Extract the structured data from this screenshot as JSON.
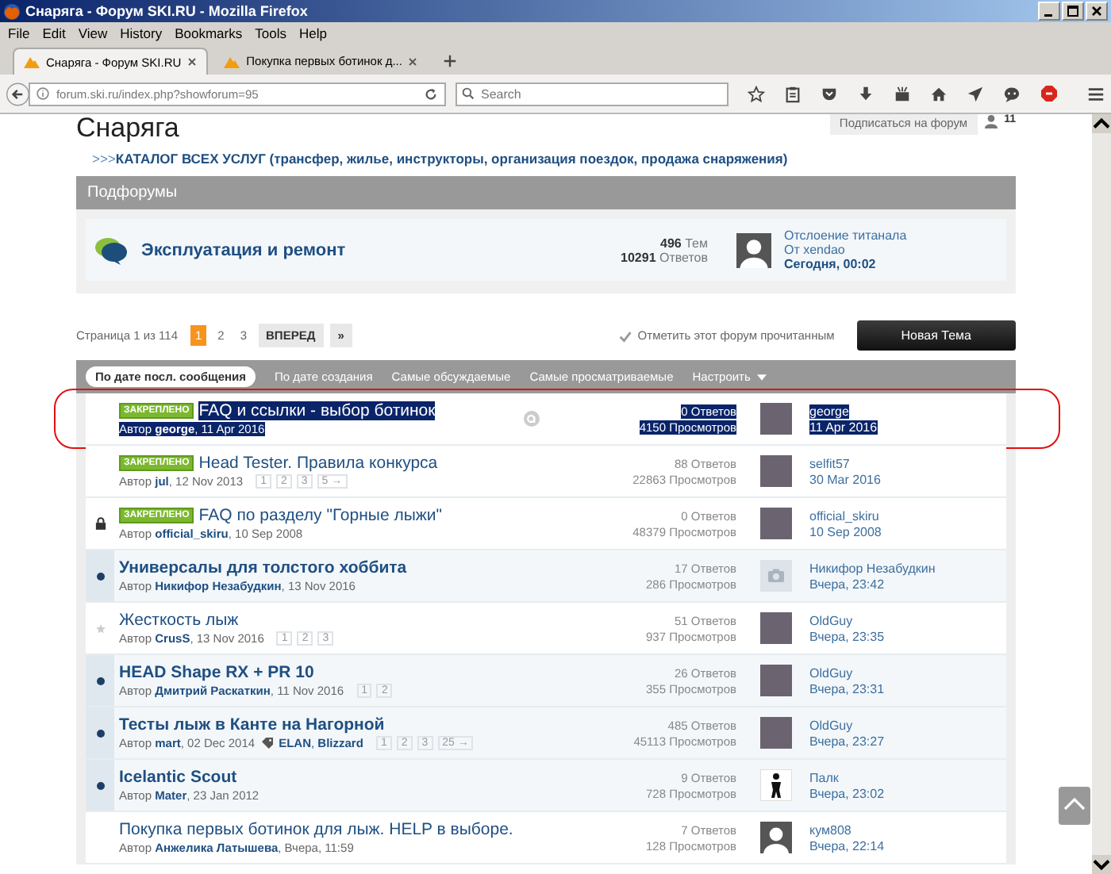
{
  "window": {
    "title": "Снаряга - Форум SKI.RU - Mozilla Firefox"
  },
  "menu": [
    {
      "label": "File"
    },
    {
      "label": "Edit"
    },
    {
      "label": "View"
    },
    {
      "label": "History"
    },
    {
      "label": "Bookmarks"
    },
    {
      "label": "Tools"
    },
    {
      "label": "Help"
    }
  ],
  "tabs": [
    {
      "label": "Снаряга - Форум SKI.RU",
      "selected": true
    },
    {
      "label": "Покупка первых ботинок д...",
      "selected": false
    }
  ],
  "address": {
    "url": "forum.ski.ru/index.php?showforum=95"
  },
  "search": {
    "placeholder": "Search"
  },
  "page": {
    "title": "Снаряга",
    "subscribe": "Подписаться на форум",
    "followers": "11",
    "catalog": ">>>**КАТАЛОГ ВСЕХ УСЛУГ (трансфер, жилье, инструкторы, организация поездок, продажа снаряжения)**"
  },
  "subforums": {
    "header": "Подфорумы",
    "items": [
      {
        "name": "Эксплуатация и ремонт",
        "topics_count": "496",
        "topics_label": "Тем",
        "replies_count": "10291",
        "replies_label": "Ответов",
        "last_title": "Отслоение титанала",
        "last_by": "От xendao",
        "last_date": "Сегодня, 00:02"
      }
    ]
  },
  "pagination": {
    "label": "Страница 1 из 114",
    "pages": [
      {
        "label": "1",
        "selected": true
      },
      {
        "label": "2",
        "selected": false
      },
      {
        "label": "3",
        "selected": false
      }
    ],
    "next": "ВПЕРЕД",
    "last": "»"
  },
  "mark_read": "Отметить этот форум прочитанным",
  "new_topic": "Новая Тема",
  "sort_tabs": [
    {
      "label": "По дате посл. сообщения",
      "selected": true
    },
    {
      "label": "По дате создания",
      "selected": false
    },
    {
      "label": "Самые обсуждаемые",
      "selected": false
    },
    {
      "label": "Самые просматриваемые",
      "selected": false
    }
  ],
  "customize": "Настроить",
  "topics": [
    {
      "unread": false,
      "badge": "ЗАКРЕПЛЕНО",
      "title": "FAQ и ссылки - выбор ботинок",
      "byline": "Автор **george**, 11 Apr 2016",
      "replies": "0 Ответов",
      "views": "4150 Просмотров",
      "avatar": {
        "kind": "photo"
      },
      "last_name": "george",
      "last_date": "11 Apr 2016",
      "selected": true,
      "circled": true,
      "hovered": true
    },
    {
      "unread": false,
      "badge": "ЗАКРЕПЛЕНО",
      "title": "Head Tester. Правила конкурса",
      "byline": "Автор **jul**, 12 Nov 2013",
      "pages": [
        "1",
        "2",
        "3",
        "5 →"
      ],
      "replies": "88 Ответов",
      "views": "22863 Просмотров",
      "avatar": {
        "kind": "photo"
      },
      "last_name": "selfit57",
      "last_date": "30 Mar 2016",
      "selected": false,
      "circled": false,
      "hovered": false
    },
    {
      "marker": {
        "kind": "lock"
      },
      "unread": false,
      "badge": "ЗАКРЕПЛЕНО",
      "title": "FAQ по разделу \"Горные лыжи\"",
      "byline": "Автор **official_skiru**, 10 Sep 2008",
      "replies": "0 Ответов",
      "views": "48379 Просмотров",
      "avatar": {
        "kind": "photo"
      },
      "last_name": "official_skiru",
      "last_date": "10 Sep 2008",
      "selected": false,
      "circled": false,
      "hovered": false
    },
    {
      "marker": {
        "kind": "dot"
      },
      "unread": true,
      "title": "Универсалы для толстого хоббита",
      "byline": "Автор **Никифор Незабудкин**, 13 Nov 2016",
      "replies": "17 Ответов",
      "views": "286 Просмотров",
      "avatar": {
        "kind": "camera"
      },
      "last_name": "Никифор Незабудкин",
      "last_date": "Вчера, 23:42",
      "selected": false,
      "circled": false,
      "hovered": false
    },
    {
      "marker": {
        "kind": "star"
      },
      "unread": false,
      "title": "Жесткость лыж",
      "byline": "Автор **CrusS**, 13 Nov 2016",
      "pages": [
        "1",
        "2",
        "3"
      ],
      "replies": "51 Ответов",
      "views": "937 Просмотров",
      "avatar": {
        "kind": "photo"
      },
      "last_name": "OldGuy",
      "last_date": "Вчера, 23:35",
      "selected": false,
      "circled": false,
      "hovered": false
    },
    {
      "marker": {
        "kind": "dot"
      },
      "unread": true,
      "title": "HEAD Shape RX + PR 10",
      "byline": "Автор **Дмитрий Раскаткин**, 11 Nov 2016",
      "pages": [
        "1",
        "2"
      ],
      "replies": "26 Ответов",
      "views": "355 Просмотров",
      "avatar": {
        "kind": "photo"
      },
      "last_name": "OldGuy",
      "last_date": "Вчера, 23:31",
      "selected": false,
      "circled": false,
      "hovered": false
    },
    {
      "marker": {
        "kind": "dot"
      },
      "unread": true,
      "title": "Тесты лыж в Канте на Нагорной",
      "byline": "Автор **mart**, 02 Dec 2014",
      "tags": "**ELAN**, **Blizzard**",
      "pages": [
        "1",
        "2",
        "3",
        "25 →"
      ],
      "replies": "485 Ответов",
      "views": "45113 Просмотров",
      "avatar": {
        "kind": "photo"
      },
      "last_name": "OldGuy",
      "last_date": "Вчера, 23:27",
      "selected": false,
      "circled": false,
      "hovered": false
    },
    {
      "marker": {
        "kind": "dot"
      },
      "unread": true,
      "title": "Icelantic Scout",
      "byline": "Автор **Mater**, 23 Jan 2012",
      "replies": "9 Ответов",
      "views": "728 Просмотров",
      "avatar": {
        "kind": "figure"
      },
      "last_name": "Палк",
      "last_date": "Вчера, 23:02",
      "selected": false,
      "circled": false,
      "hovered": false
    },
    {
      "unread": false,
      "title": "Покупка первых ботинок для лыж. HELP в выборе.",
      "byline": "Автор **Анжелика Латышева**, Вчера, 11:59",
      "replies": "7 Ответов",
      "views": "128 Просмотров",
      "avatar": {
        "kind": "silhouette"
      },
      "last_name": "кум808",
      "last_date": "Вчера, 22:14",
      "selected": false,
      "circled": false,
      "hovered": false
    }
  ]
}
